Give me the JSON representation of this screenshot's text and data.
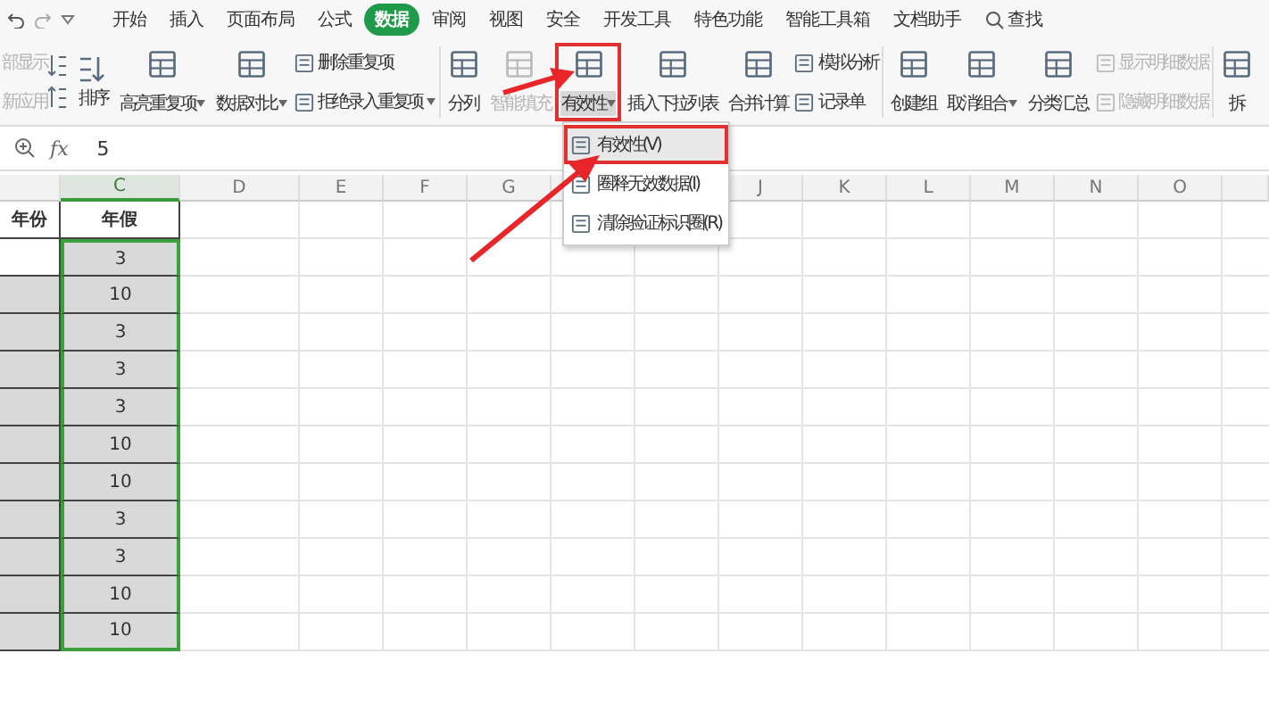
{
  "menu_bar": {
    "tabs": [
      {
        "label": "开始",
        "selected": false
      },
      {
        "label": "插入",
        "selected": false
      },
      {
        "label": "页面布局",
        "selected": false
      },
      {
        "label": "公式",
        "selected": false
      },
      {
        "label": "数据",
        "selected": true
      },
      {
        "label": "审阅",
        "selected": false
      },
      {
        "label": "视图",
        "selected": false
      },
      {
        "label": "安全",
        "selected": false
      },
      {
        "label": "开发工具",
        "selected": false
      },
      {
        "label": "特色功能",
        "selected": false
      },
      {
        "label": "智能工具箱",
        "selected": false
      },
      {
        "label": "文档助手",
        "selected": false
      }
    ],
    "search": "查找"
  },
  "ribbon": [
    {
      "kind": "stack",
      "clipped": true,
      "items": [
        {
          "label": "部显示",
          "dropdown": false,
          "disabled": true
        },
        {
          "label": "新应用",
          "dropdown": false,
          "disabled": true
        }
      ]
    },
    {
      "kind": "sort",
      "label": "排序"
    },
    {
      "kind": "large",
      "label": "高亮重复项",
      "dropdown": true,
      "disabled": false,
      "annotated": false
    },
    {
      "kind": "large",
      "label": "数据对比",
      "dropdown": true,
      "disabled": false,
      "annotated": false
    },
    {
      "kind": "stack",
      "clipped": false,
      "items": [
        {
          "label": "删除重复项",
          "dropdown": false,
          "disabled": false
        },
        {
          "label": "拒绝录入重复项",
          "dropdown": true,
          "disabled": false
        }
      ]
    },
    {
      "kind": "separator"
    },
    {
      "kind": "large",
      "label": "分列",
      "dropdown": false,
      "disabled": false,
      "annotated": false
    },
    {
      "kind": "large",
      "label": "智能填充",
      "dropdown": false,
      "disabled": true,
      "annotated": false
    },
    {
      "kind": "large",
      "label": "有效性",
      "dropdown": true,
      "disabled": false,
      "annotated": true,
      "menu": [
        {
          "label": "有效性(V)",
          "selected": true
        },
        {
          "label": "圈释无效数据(I)",
          "selected": false
        },
        {
          "label": "清除验证标识圈(R)",
          "selected": false
        }
      ]
    },
    {
      "kind": "large",
      "label": "插入下拉列表",
      "dropdown": false,
      "disabled": false,
      "annotated": false
    },
    {
      "kind": "large",
      "label": "合并计算",
      "dropdown": false,
      "disabled": false,
      "annotated": false
    },
    {
      "kind": "stack",
      "clipped": false,
      "items": [
        {
          "label": "模拟分析",
          "dropdown": false,
          "disabled": false
        },
        {
          "label": "记录单",
          "dropdown": false,
          "disabled": false
        }
      ]
    },
    {
      "kind": "separator"
    },
    {
      "kind": "large",
      "label": "创建组",
      "dropdown": false,
      "disabled": false,
      "annotated": false
    },
    {
      "kind": "large",
      "label": "取消组合",
      "dropdown": true,
      "disabled": false,
      "annotated": false
    },
    {
      "kind": "large",
      "label": "分类汇总",
      "dropdown": false,
      "disabled": false,
      "annotated": false
    },
    {
      "kind": "stack",
      "clipped": false,
      "items": [
        {
          "label": "显示明细数据",
          "dropdown": false,
          "disabled": true
        },
        {
          "label": "隐藏明细数据",
          "dropdown": false,
          "disabled": true
        }
      ]
    },
    {
      "kind": "separator"
    },
    {
      "kind": "large",
      "label": "拆",
      "dropdown": false,
      "disabled": false,
      "annotated": false
    }
  ],
  "formula_bar": {
    "fx": "fx",
    "value": "5"
  },
  "sheet": {
    "columns": [
      {
        "label": "C",
        "selected": true
      },
      {
        "label": "D",
        "selected": false
      },
      {
        "label": "E",
        "selected": false
      },
      {
        "label": "F",
        "selected": false
      },
      {
        "label": "G",
        "selected": false
      },
      {
        "label": "J",
        "selected": false
      },
      {
        "label": "K",
        "selected": false
      },
      {
        "label": "L",
        "selected": false
      },
      {
        "label": "M",
        "selected": false
      },
      {
        "label": "N",
        "selected": false
      },
      {
        "label": "O",
        "selected": false
      }
    ],
    "rows": [
      {
        "kind": "header",
        "cells": [
          "年份",
          "年假"
        ]
      },
      {
        "kind": "data",
        "b_shaded": false,
        "value": "3",
        "selected": true
      },
      {
        "kind": "data",
        "b_shaded": true,
        "value": "10",
        "selected": true
      },
      {
        "kind": "data",
        "b_shaded": true,
        "value": "3",
        "selected": true
      },
      {
        "kind": "data",
        "b_shaded": true,
        "value": "3",
        "selected": true
      },
      {
        "kind": "data",
        "b_shaded": true,
        "value": "3",
        "selected": true
      },
      {
        "kind": "data",
        "b_shaded": true,
        "value": "10",
        "selected": true
      },
      {
        "kind": "data",
        "b_shaded": true,
        "value": "10",
        "selected": true
      },
      {
        "kind": "data",
        "b_shaded": true,
        "value": "3",
        "selected": true
      },
      {
        "kind": "data",
        "b_shaded": true,
        "value": "3",
        "selected": true
      },
      {
        "kind": "data",
        "b_shaded": true,
        "value": "10",
        "selected": true
      },
      {
        "kind": "data",
        "b_shaded": true,
        "value": "10",
        "selected": true
      }
    ]
  }
}
